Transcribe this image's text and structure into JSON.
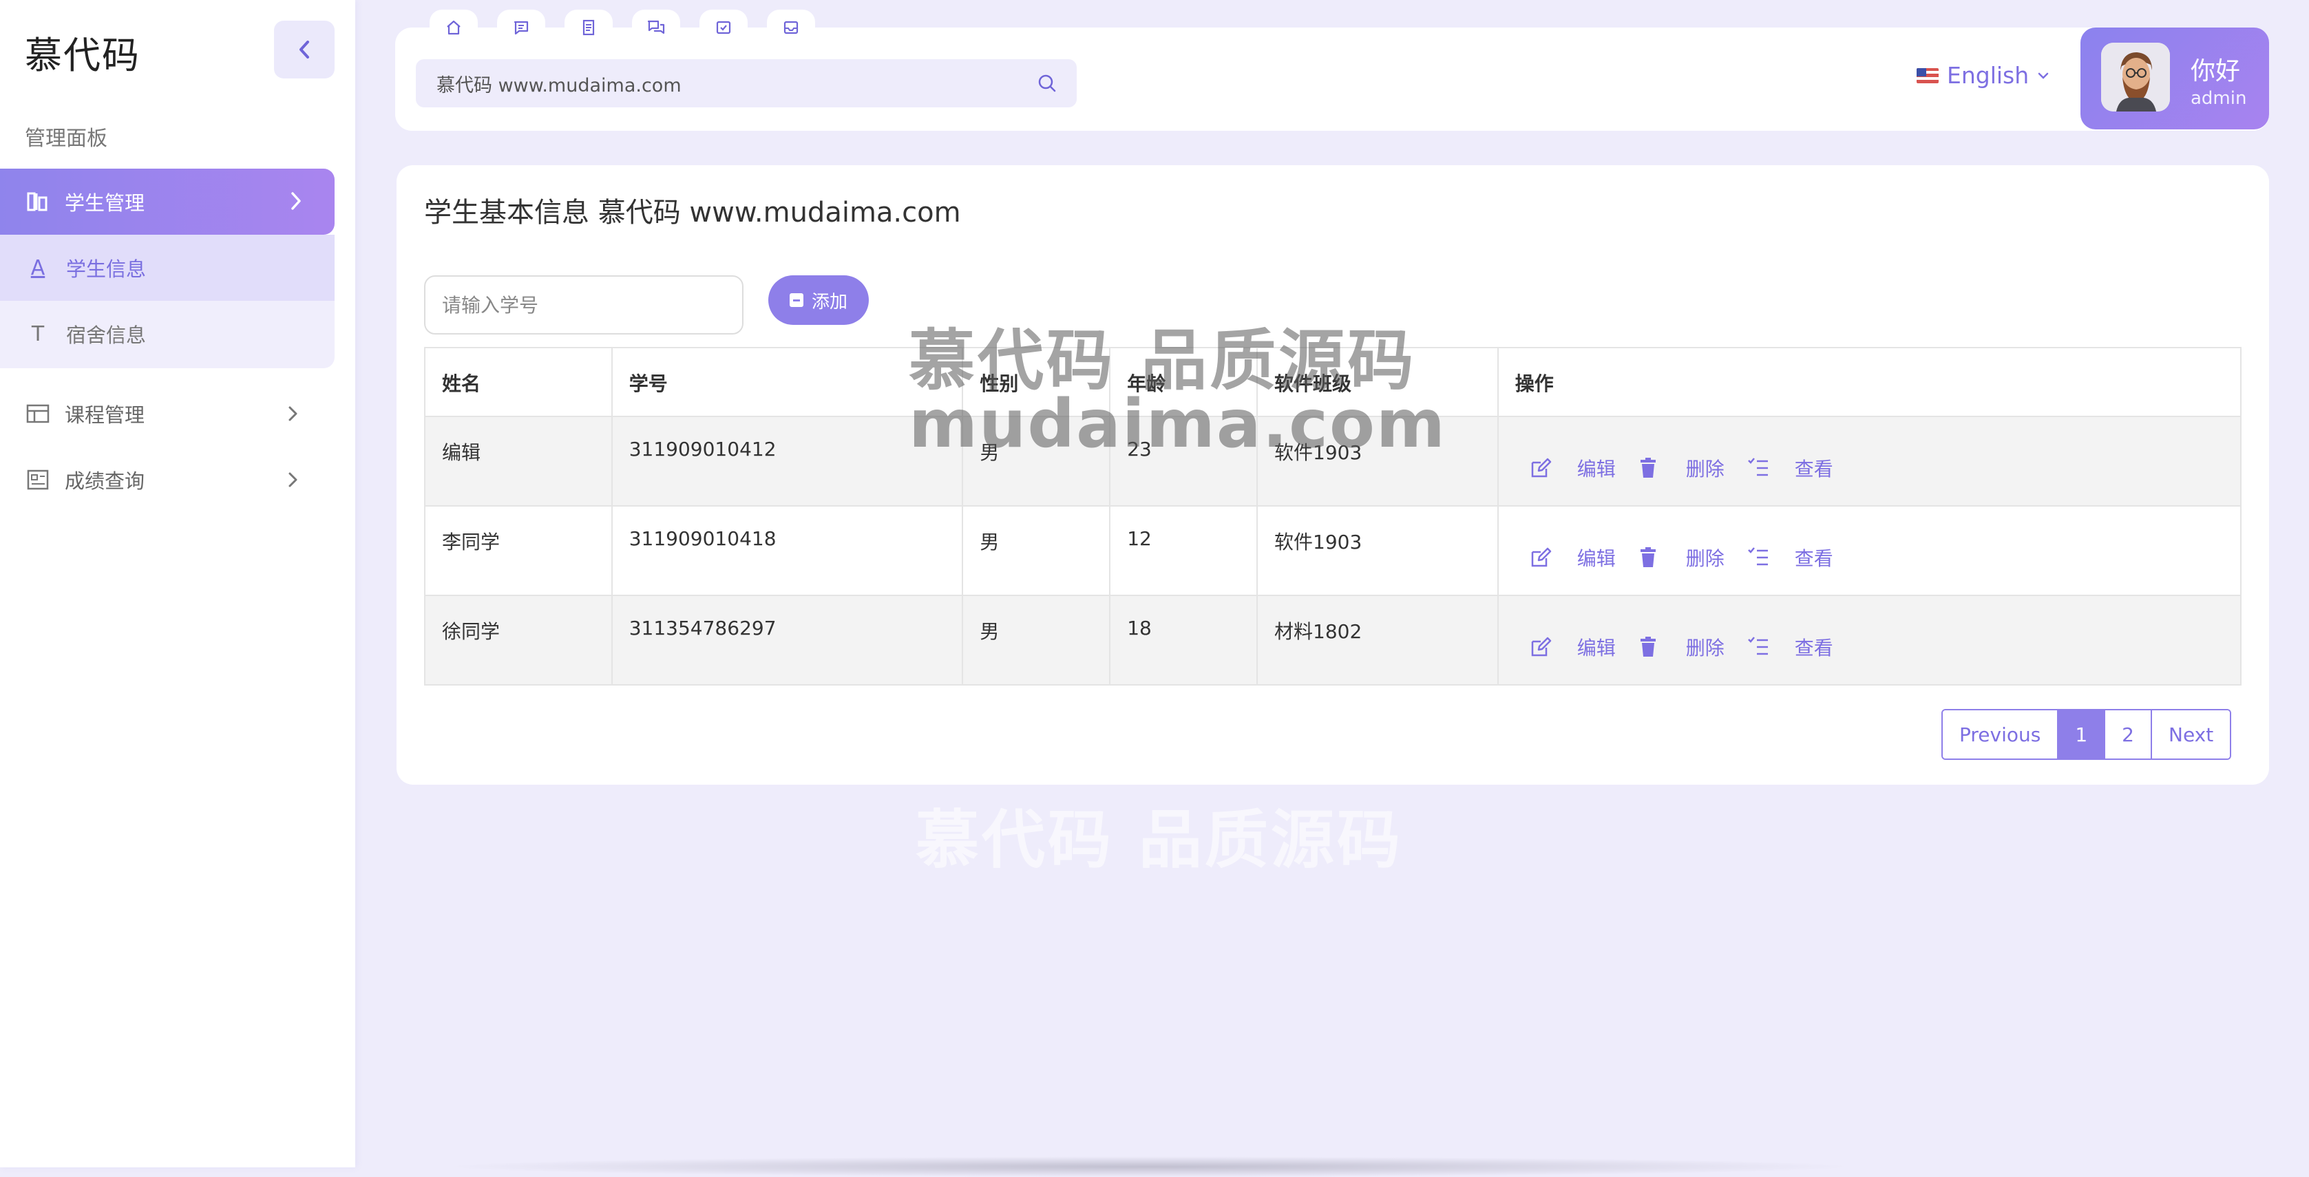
{
  "sidebar": {
    "brand": "慕代码",
    "section_label": "管理面板",
    "active_item": {
      "label": "学生管理"
    },
    "sub_items": [
      {
        "letter": "A",
        "label": "学生信息"
      },
      {
        "letter": "T",
        "label": "宿舍信息"
      }
    ],
    "items": [
      {
        "label": "课程管理"
      },
      {
        "label": "成绩查询"
      }
    ]
  },
  "header": {
    "quick_icons": [
      "home-icon",
      "message-icon",
      "document-icon",
      "chat-icon",
      "calendar-check-icon",
      "inbox-icon"
    ],
    "search_text": "慕代码 www.mudaima.com",
    "language": "English",
    "greeting": "你好",
    "username": "admin"
  },
  "main": {
    "title": "学生基本信息 慕代码 www.mudaima.com",
    "search_placeholder": "请输入学号",
    "add_label": "添加",
    "columns": [
      "姓名",
      "学号",
      "性别",
      "年龄",
      "软件班级",
      "操作"
    ],
    "rows": [
      {
        "name": "编辑",
        "id": "311909010412",
        "gender": "男",
        "age": "23",
        "class": "软件1903"
      },
      {
        "name": "李同学",
        "id": "311909010418",
        "gender": "男",
        "age": "12",
        "class": "软件1903"
      },
      {
        "name": "徐同学",
        "id": "311354786297",
        "gender": "男",
        "age": "18",
        "class": "材料1802"
      }
    ],
    "actions": {
      "edit": "编辑",
      "delete": "删除",
      "view": "查看"
    },
    "pagination": {
      "previous": "Previous",
      "pages": [
        "1",
        "2"
      ],
      "next": "Next"
    }
  },
  "watermarks": {
    "line1": "慕代码 品质源码",
    "line2": "mudaima.com",
    "line3": "慕代码 品质源码"
  },
  "colors": {
    "accent": "#8e7fe9",
    "background": "#eeecfb"
  }
}
